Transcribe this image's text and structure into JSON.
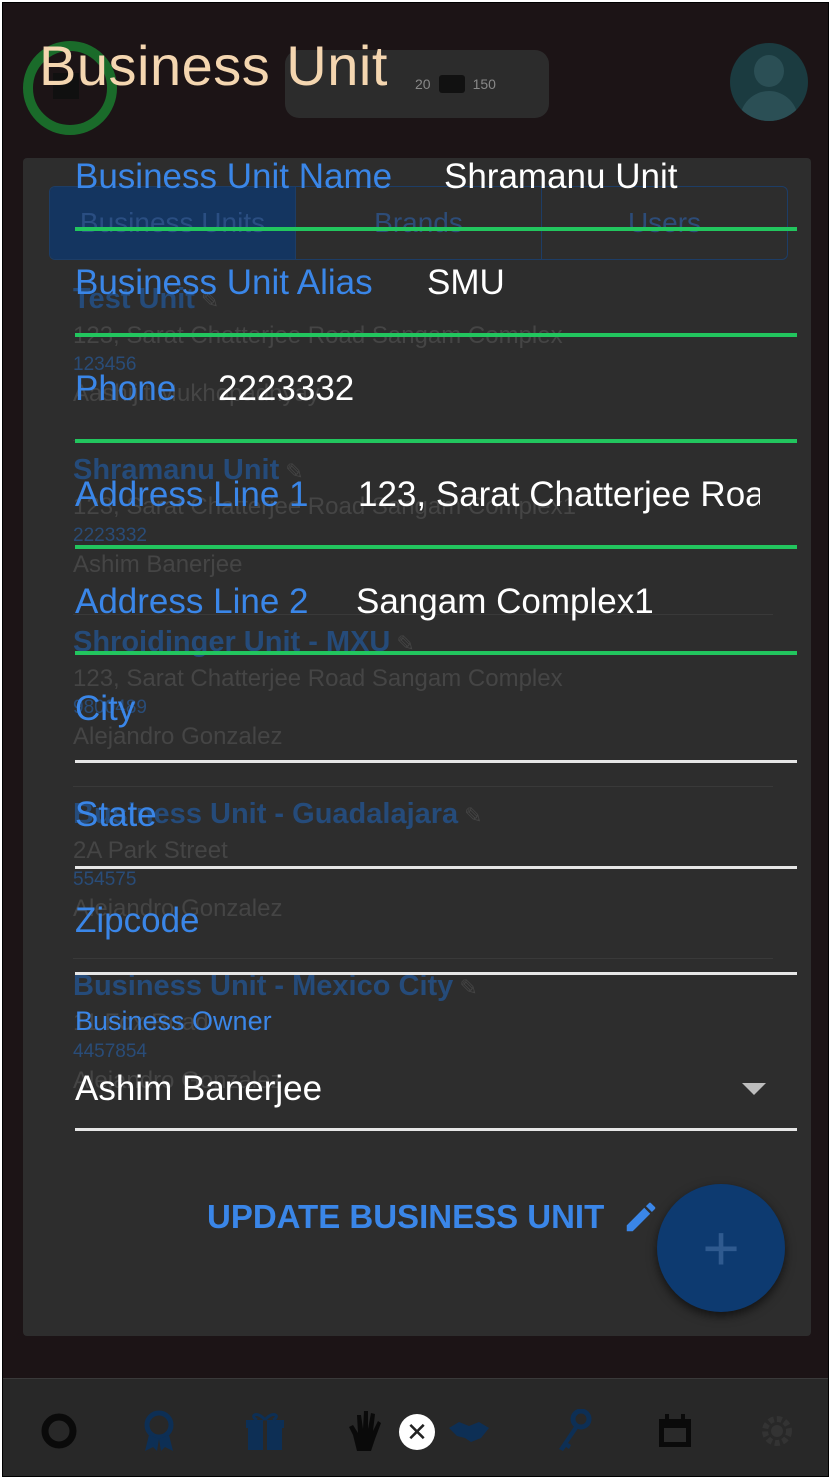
{
  "dialog": {
    "title": "Business Unit",
    "fields": {
      "name": {
        "label": "Business Unit Name",
        "value": "Shramanu Unit"
      },
      "alias": {
        "label": "Business Unit Alias",
        "value": "SMU"
      },
      "phone": {
        "label": "Phone",
        "value": "2223332"
      },
      "address1": {
        "label": "Address Line 1",
        "value": "123, Sarat Chatterjee Roa"
      },
      "address2": {
        "label": "Address Line 2",
        "value": "Sangam Complex1"
      },
      "city": {
        "label": "City",
        "value": ""
      },
      "state": {
        "label": "State",
        "value": ""
      },
      "zipcode": {
        "label": "Zipcode",
        "value": ""
      }
    },
    "owner": {
      "label": "Business Owner",
      "value": "Ashim Banerjee"
    },
    "update_label": "UPDATE BUSINESS UNIT"
  },
  "background": {
    "counter": {
      "first": "20",
      "second": "150"
    },
    "tabs": [
      "Business Units",
      "Brands",
      "Users"
    ],
    "units": [
      {
        "name": "Test Unit",
        "address": "123, Sarat Chatterjee Road Sangam Complex",
        "phone": "123456",
        "owner": "Aashijit Mukhopadhyay"
      },
      {
        "name": "Shramanu Unit",
        "address": "123, Sarat Chatterjee Road Sangam Complex1",
        "phone": "2223332",
        "owner": "Ashim Banerjee"
      },
      {
        "name": "Shroidinger Unit - MXU",
        "address": "123, Sarat Chatterjee Road Sangam Complex",
        "phone": "9800489",
        "owner": "Alejandro Gonzalez"
      },
      {
        "name": "Business Unit - Guadalajara",
        "address": "2A Park Street",
        "phone": "554575",
        "owner": "Alejandro Gonzalez"
      },
      {
        "name": "Business Unit - Mexico City",
        "address": "11 Fox Road",
        "phone": "4457854",
        "owner": "Alejandro Gonzalez"
      }
    ]
  },
  "fab_label": "+",
  "icons": [
    "circle-logo-icon",
    "award-icon",
    "gift-icon",
    "hand-icon",
    "close-icon",
    "handshake-icon",
    "key-icon",
    "calendar-icon",
    "gear-icon",
    "pencil-icon",
    "plus-icon",
    "caret-down-icon"
  ],
  "colors": {
    "accent": "#3a86e8",
    "valid_underline": "#22c55e",
    "title": "#f4d6b0"
  }
}
